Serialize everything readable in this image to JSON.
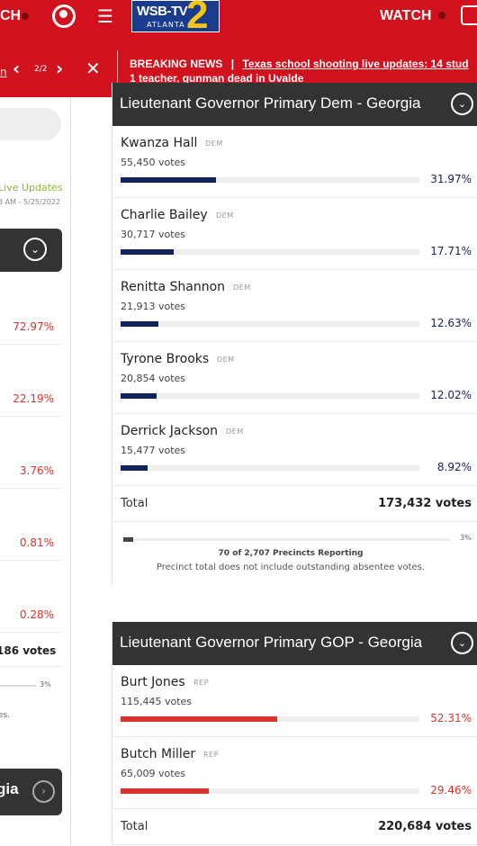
{
  "topbar": {
    "watch_left": "CH",
    "logo_text": "WSB-TV",
    "logo_sub": "ATLANTA",
    "logo_num": "2",
    "watch_label": "WATCH"
  },
  "breaking": {
    "count": "2/2",
    "label": "BREAKING NEWS",
    "sep": "|",
    "headline_1": "Texas school shooting live updates: 14 stud",
    "headline_2": "1 teacher, gunman dead in Uvalde",
    "left_dot": "n"
  },
  "left_col": {
    "live": "Live Updates",
    "date": "3 AM - 5/25/2022",
    "pcts": [
      "72.97%",
      "22.19%",
      "3.76%",
      "0.81%",
      "0.28%"
    ],
    "total_votes": "186 votes",
    "prec_pct": "3%",
    "note_fragment": "es.",
    "next_title": "gia"
  },
  "dem_race": {
    "title": "Lieutenant Governor Primary Dem - Georgia",
    "candidates": [
      {
        "name": "Kwanza Hall",
        "party": "DEM",
        "votes": "55,450 votes",
        "pct": "31.97%",
        "share": 31.97
      },
      {
        "name": "Charlie Bailey",
        "party": "DEM",
        "votes": "30,717 votes",
        "pct": "17.71%",
        "share": 17.71
      },
      {
        "name": "Renitta Shannon",
        "party": "DEM",
        "votes": "21,913 votes",
        "pct": "12.63%",
        "share": 12.63
      },
      {
        "name": "Tyrone Brooks",
        "party": "DEM",
        "votes": "20,854 votes",
        "pct": "12.02%",
        "share": 12.02
      },
      {
        "name": "Derrick Jackson",
        "party": "DEM",
        "votes": "15,477 votes",
        "pct": "8.92%",
        "share": 8.92
      }
    ],
    "total_label": "Total",
    "total_votes": "173,432 votes",
    "precincts_pct": "3%",
    "precincts_share": 3,
    "precincts_text": "70 of 2,707 Precincts Reporting",
    "precincts_note": "Precinct total does not include outstanding absentee votes."
  },
  "gop_race": {
    "title": "Lieutenant Governor Primary GOP - Georgia",
    "candidates": [
      {
        "name": "Burt Jones",
        "party": "REP",
        "votes": "115,445 votes",
        "pct": "52.31%",
        "share": 52.31
      },
      {
        "name": "Butch Miller",
        "party": "REP",
        "votes": "65,009 votes",
        "pct": "29.46%",
        "share": 29.46
      }
    ],
    "total_label": "Total",
    "total_votes": "220,684 votes"
  },
  "colors": {
    "brand_red": "#d1111e",
    "dem_blue": "#0f2259",
    "rep_red": "#d9342b"
  }
}
